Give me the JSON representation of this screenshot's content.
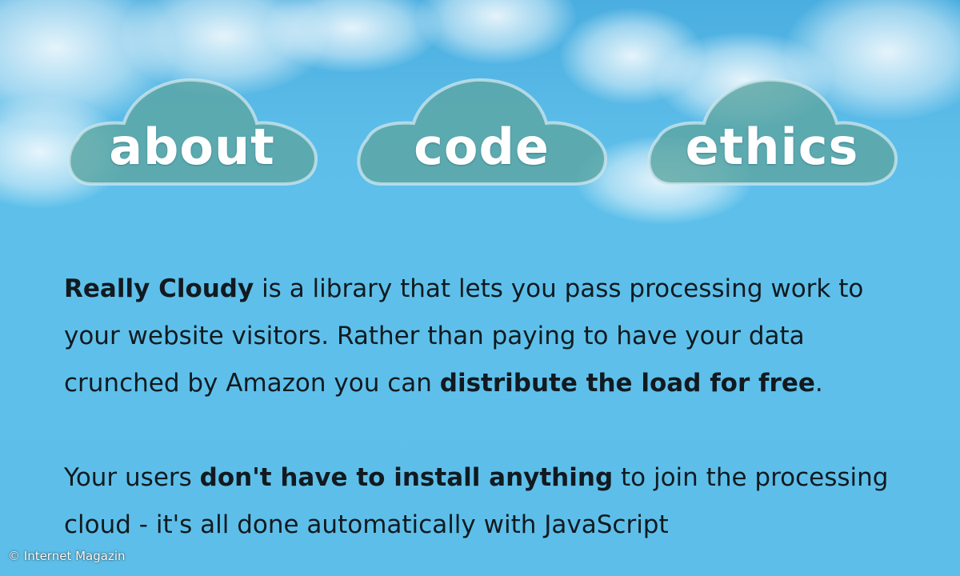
{
  "nav": {
    "items": [
      {
        "label": "about"
      },
      {
        "label": "code"
      },
      {
        "label": "ethics"
      }
    ]
  },
  "intro": {
    "brand": "Really Cloudy",
    "text1": " is a library that lets you pass processing work to your website visitors. Rather than paying to have your data crunched by Amazon you can ",
    "bold1": "distribute the load for free",
    "text2": "."
  },
  "second": {
    "text1": "Your users ",
    "bold1": "don't have to install anything",
    "text2": " to join the processing cloud - it's all done automatically with JavaScript"
  },
  "watermark": {
    "text": "© Internet Magazin"
  },
  "colors": {
    "sky": "#5dbfe9",
    "cloud_fill": "#5fa8a8",
    "nav_text": "#ffffff",
    "body_text": "#111a20"
  }
}
